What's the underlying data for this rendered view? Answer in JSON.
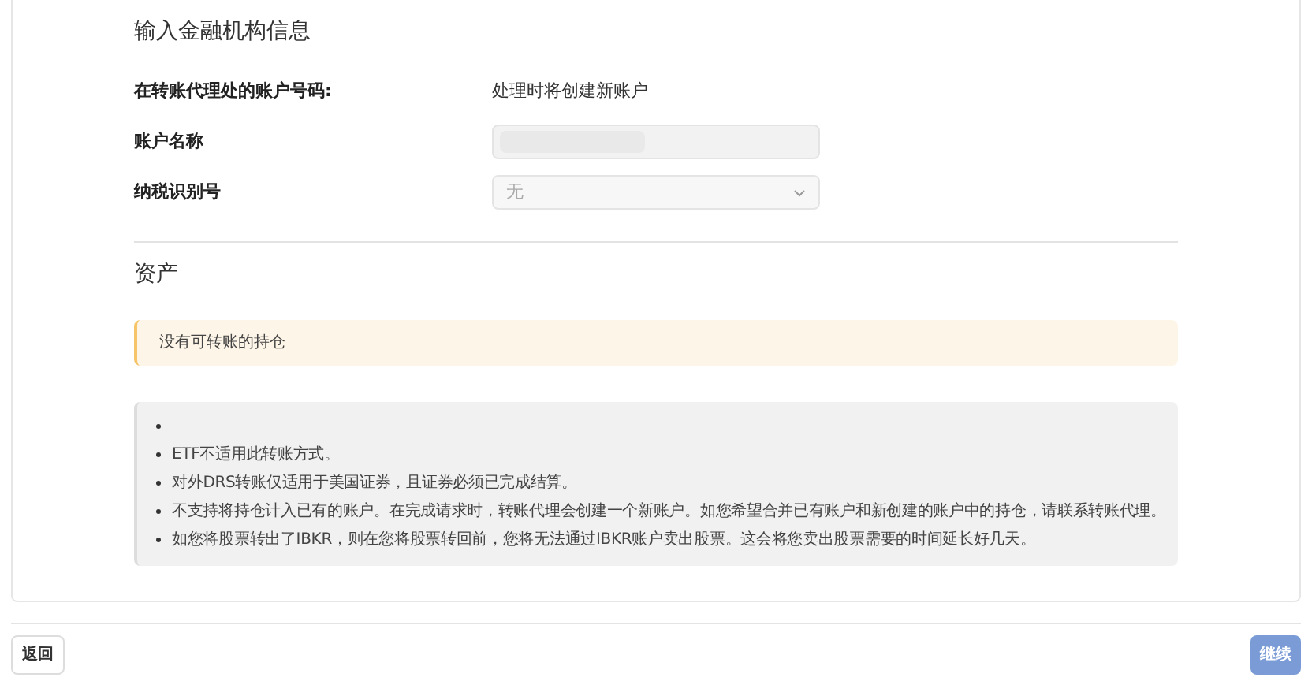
{
  "section_title": "输入金融机构信息",
  "fields": [
    {
      "kind": "text",
      "label": "在转账代理处的账户号码:",
      "value": "处理时将创建新账户"
    },
    {
      "kind": "input",
      "label": "账户名称",
      "disabled": true
    },
    {
      "kind": "select",
      "label": "纳税识别号",
      "value": "无",
      "disabled": true
    }
  ],
  "assets": {
    "title": "资产",
    "notice": "没有可转账的持仓"
  },
  "notes": [
    "ETF不适用此转账方式。",
    "对外DRS转账仅适用于美国证券，且证券必须已完成结算。",
    "不支持将持仓计入已有的账户。在完成请求时，转账代理会创建一个新账户。如您希望合并已有账户和新创建的账户中的持仓，请联系转账代理。",
    "如您将股票转出了IBKR，则在您将股票转回前，您将无法通过IBKR账户卖出股票。这会将您卖出股票需要的时间延长好几天。"
  ],
  "footer": {
    "back": "返回",
    "continue": {
      "label": "继续",
      "disabled": true
    }
  }
}
